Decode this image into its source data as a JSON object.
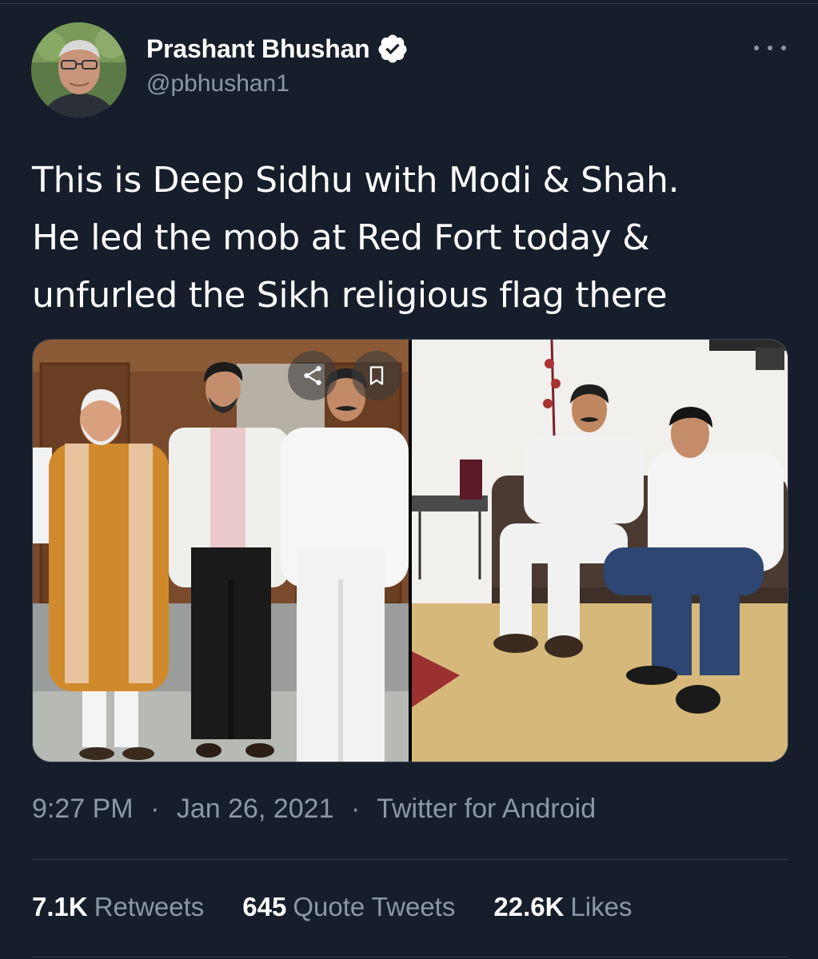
{
  "author": {
    "name": "Prashant Bhushan",
    "handle": "@pbhushan1",
    "verified": true
  },
  "tweet": {
    "lines": [
      "This is Deep Sidhu with Modi & Shah.",
      "He led the mob at Red Fort today &",
      "unfurled the Sikh religious flag there"
    ]
  },
  "meta": {
    "time": "9:27 PM",
    "separator": "·",
    "date": "Jan 26, 2021",
    "source": "Twitter for Android"
  },
  "stats": {
    "retweets_count": "7.1K",
    "retweets_label": "Retweets",
    "quotes_count": "645",
    "quotes_label": "Quote Tweets",
    "likes_count": "22.6K",
    "likes_label": "Likes"
  },
  "colors": {
    "background": "#151e2a",
    "text_primary": "#ffffff",
    "text_secondary": "#8b98a5",
    "verified": "#ffffff",
    "divider": "#36424f"
  },
  "icons": {
    "more": "more-horizontal-icon",
    "verified": "verified-badge-icon",
    "share": "share-icon",
    "bookmark": "bookmark-icon"
  }
}
